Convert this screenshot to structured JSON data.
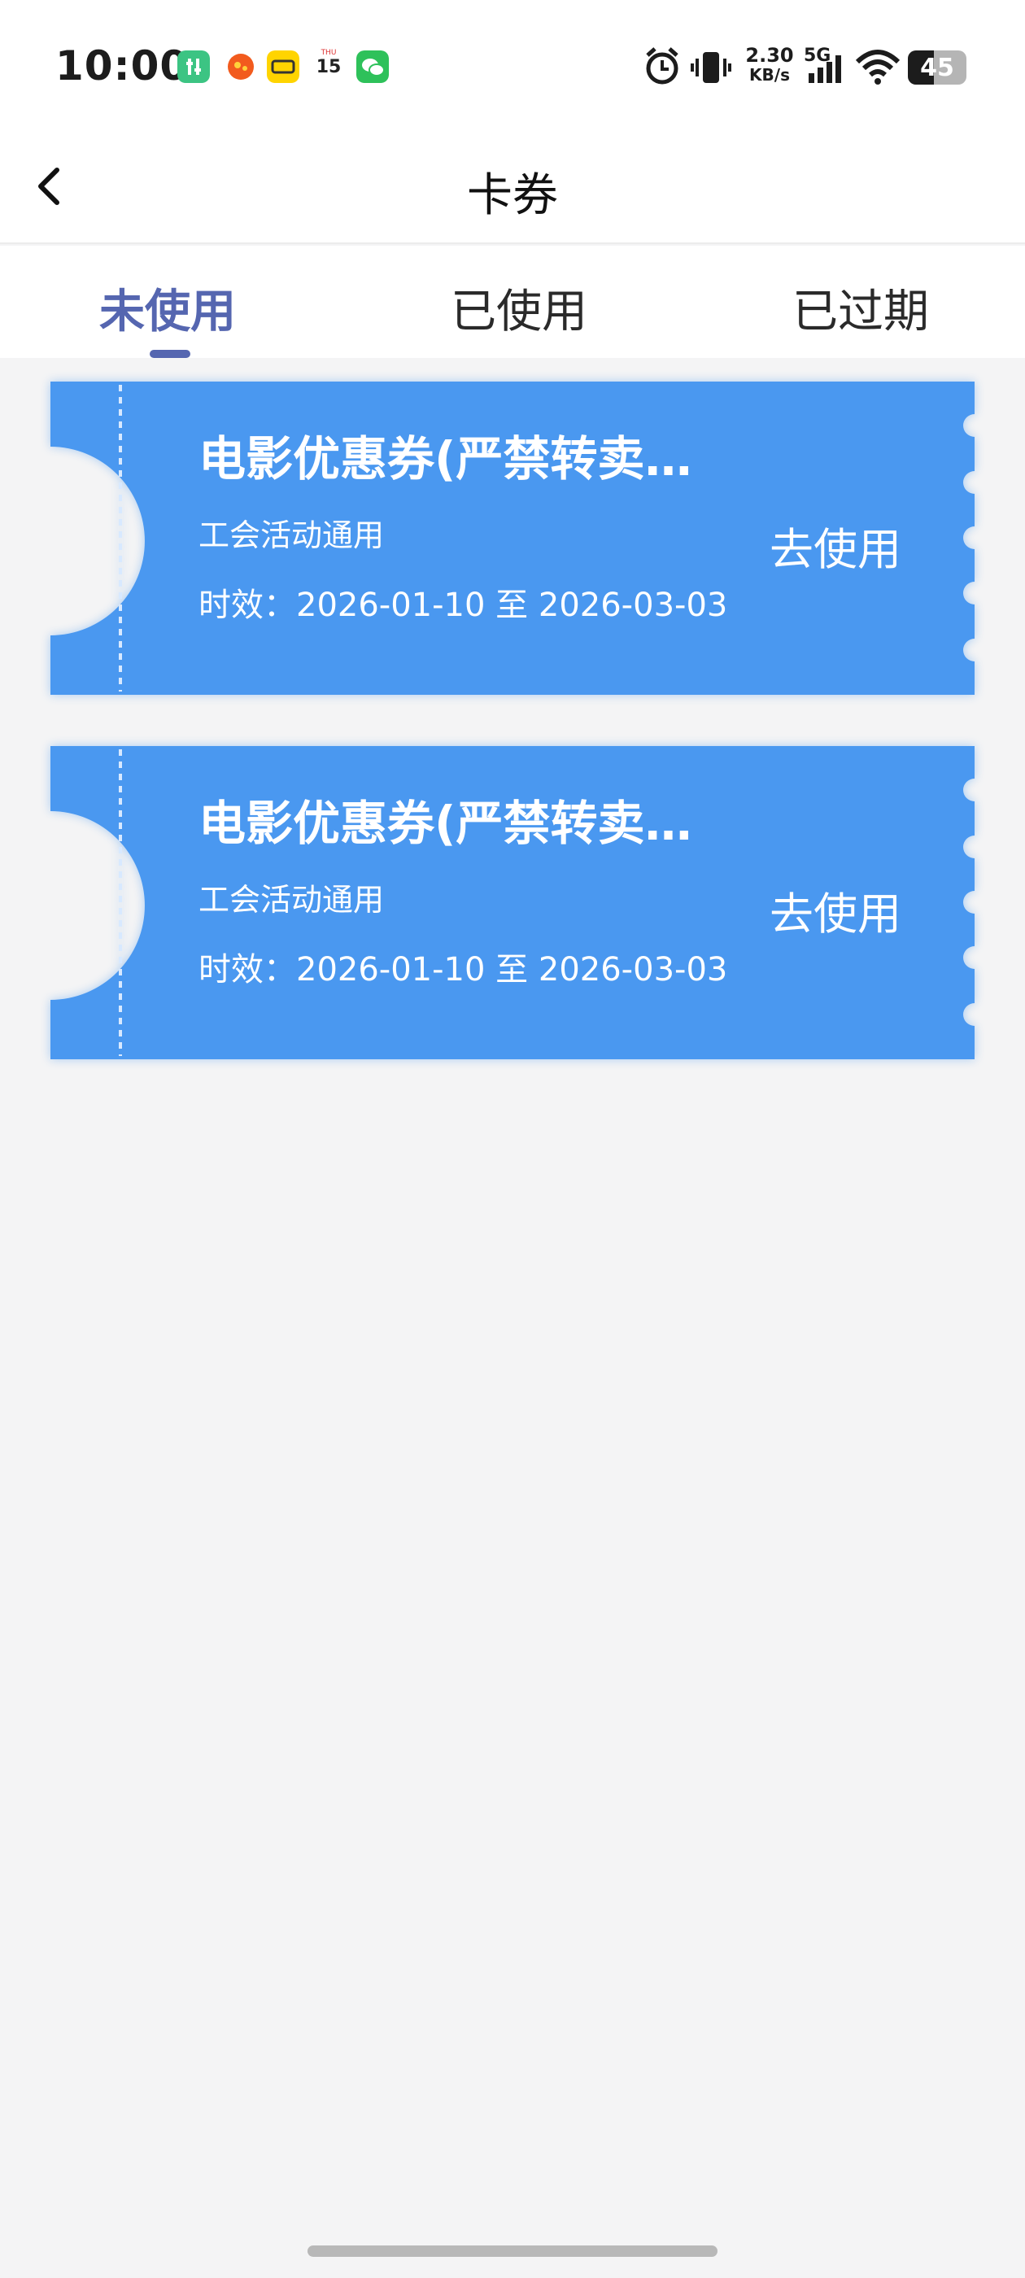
{
  "status_bar": {
    "time": "10:00",
    "net_speed_value": "2.30",
    "net_speed_unit": "KB/s",
    "network_type": "5G",
    "battery": "45",
    "calendar_day": "15",
    "calendar_label": "THU",
    "app_icons": [
      "tasks-app-icon",
      "orange-app-icon",
      "fare-app-icon",
      "calendar-app-icon",
      "wechat-app-icon"
    ]
  },
  "header": {
    "title": "卡券"
  },
  "tabs": [
    {
      "label": "未使用",
      "active": true
    },
    {
      "label": "已使用",
      "active": false
    },
    {
      "label": "已过期",
      "active": false
    }
  ],
  "coupons": [
    {
      "title": "电影优惠券(严禁转卖…",
      "subtitle": "工会活动通用",
      "validity": "时效：2026-01-10 至 2026-03-03",
      "action": "去使用"
    },
    {
      "title": "电影优惠券(严禁转卖…",
      "subtitle": "工会活动通用",
      "validity": "时效：2026-01-10 至 2026-03-03",
      "action": "去使用"
    }
  ],
  "colors": {
    "coupon_blue": "#4a98f0",
    "tab_active": "#5566b0",
    "page_bg": "#f4f4f5"
  }
}
